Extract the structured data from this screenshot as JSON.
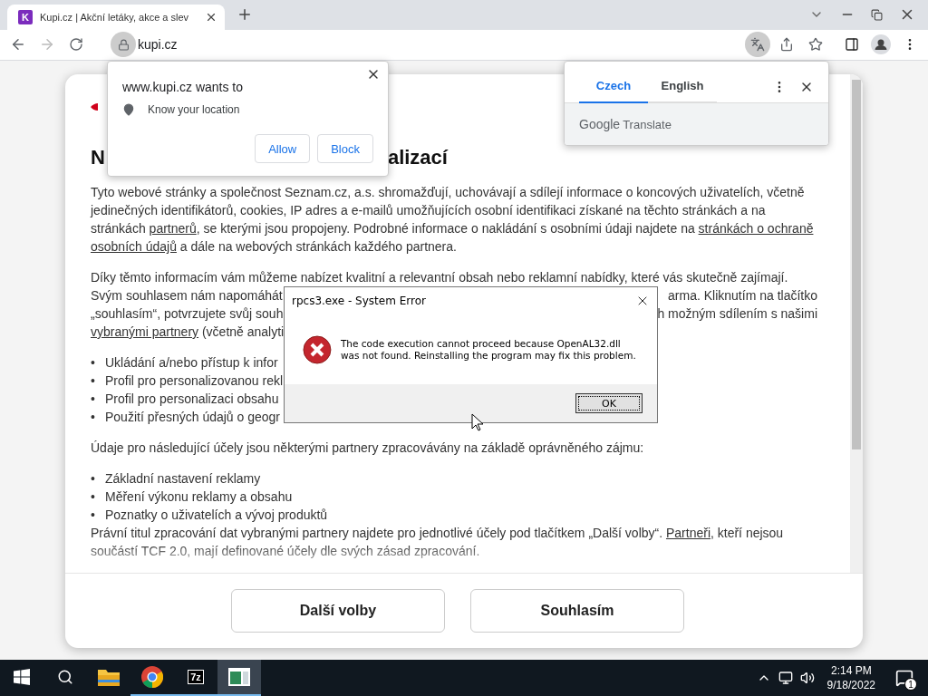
{
  "browser": {
    "favicon": "K",
    "tab_title": "Kupi.cz | Akční letáky, akce a slev",
    "address": "kupi.cz",
    "translate_active": true
  },
  "consent": {
    "heading": [
      "N",
      "alizací"
    ],
    "paragraph_1": [
      {
        "text": "Tyto webové stránky a společnost Seznam.cz, a.s. shromažďují, uchovávají a sdílejí informace o koncových uživatelích, včetně jedinečných identifikátorů, cookies, IP adres a e-mailů umožňujících osobní identifikaci získané na těchto stránkách a na stránkách "
      },
      {
        "text": "partnerů",
        "link": true
      },
      {
        "text": ", se kterými jsou propojeny. Podrobné informace o nakládání s osobními údaji najdete na "
      },
      {
        "text": "stránkách o ochraně",
        "link": true
      },
      {
        "text": "osobních údajů",
        "link": true
      },
      {
        "text": " a dále na webových stránkách každého partnera."
      }
    ],
    "paragraph_2_lines": [
      {
        "left": [
          {
            "text": "Díky těmto informacím vám můžeme nabízet kvalitní a relevantní obsah nebo reklamní nabídky, které vás skutečně zajímají."
          }
        ]
      },
      {
        "left": [
          {
            "text": "Svým souhlasem nám napomáhát"
          }
        ],
        "right": "arma. Kliknutím na tlačítko"
      },
      {
        "left": [
          {
            "text": "„souhlasím“, potvrzujete svůj souh"
          }
        ],
        "right": "h možným sdílením s našimi"
      },
      {
        "left": [
          {
            "text": "vybranými partnery",
            "link": true
          },
          {
            "text": " (včetně analyti"
          }
        ]
      }
    ],
    "marker": "•",
    "bullets_1": [
      "Ukládání a/nebo přístup k infor",
      "Profil pro personalizovanou rekl",
      "Profil pro personalizaci obsahu",
      "Použití přesných údajů o geogr"
    ],
    "paragraph_3": "Údaje pro následující účely jsou některými partnery zpracovávány na základě oprávněného zájmu:",
    "bullets_2": [
      "Základní nastavení reklamy",
      "Měření výkonu reklamy a obsahu",
      "Poznatky o uživatelích a vývoj produktů"
    ],
    "paragraph_4": [
      {
        "text": "Právní titul zpracování dat vybranými partnery najdete pro jednotlivé účely pod tlačítkem „Další volby“. "
      },
      {
        "text": "Partneři",
        "link": true
      },
      {
        "text": ", kteří nejsou součástí TCF 2.0, mají definované účely dle svých zásad zpracování."
      }
    ],
    "buttons": [
      "Další volby",
      "Souhlasím"
    ]
  },
  "permission_popup": {
    "title": "www.kupi.cz wants to",
    "request": "Know your location",
    "buttons": [
      "Allow",
      "Block"
    ]
  },
  "translate_popup": {
    "tabs": [
      {
        "label": "Czech",
        "selected": true
      },
      {
        "label": "English",
        "selected": false
      }
    ],
    "brand": "Google",
    "product": "Translate"
  },
  "error_dialog": {
    "title": "rpcs3.exe - System Error",
    "message": "The code execution cannot proceed because OpenAL32.dll was not found. Reinstalling the program may fix this problem.",
    "button": "OK"
  },
  "taskbar": {
    "apps": [
      {
        "kind": "explorer",
        "running": false,
        "selected": false
      },
      {
        "kind": "chrome",
        "running": true,
        "selected": false
      },
      {
        "kind": "archiver",
        "label": "7z",
        "running": true,
        "selected": false
      },
      {
        "kind": "window",
        "running": true,
        "selected": true
      }
    ],
    "time": "2:14 PM",
    "date": "9/18/2022",
    "notifications": "1"
  }
}
